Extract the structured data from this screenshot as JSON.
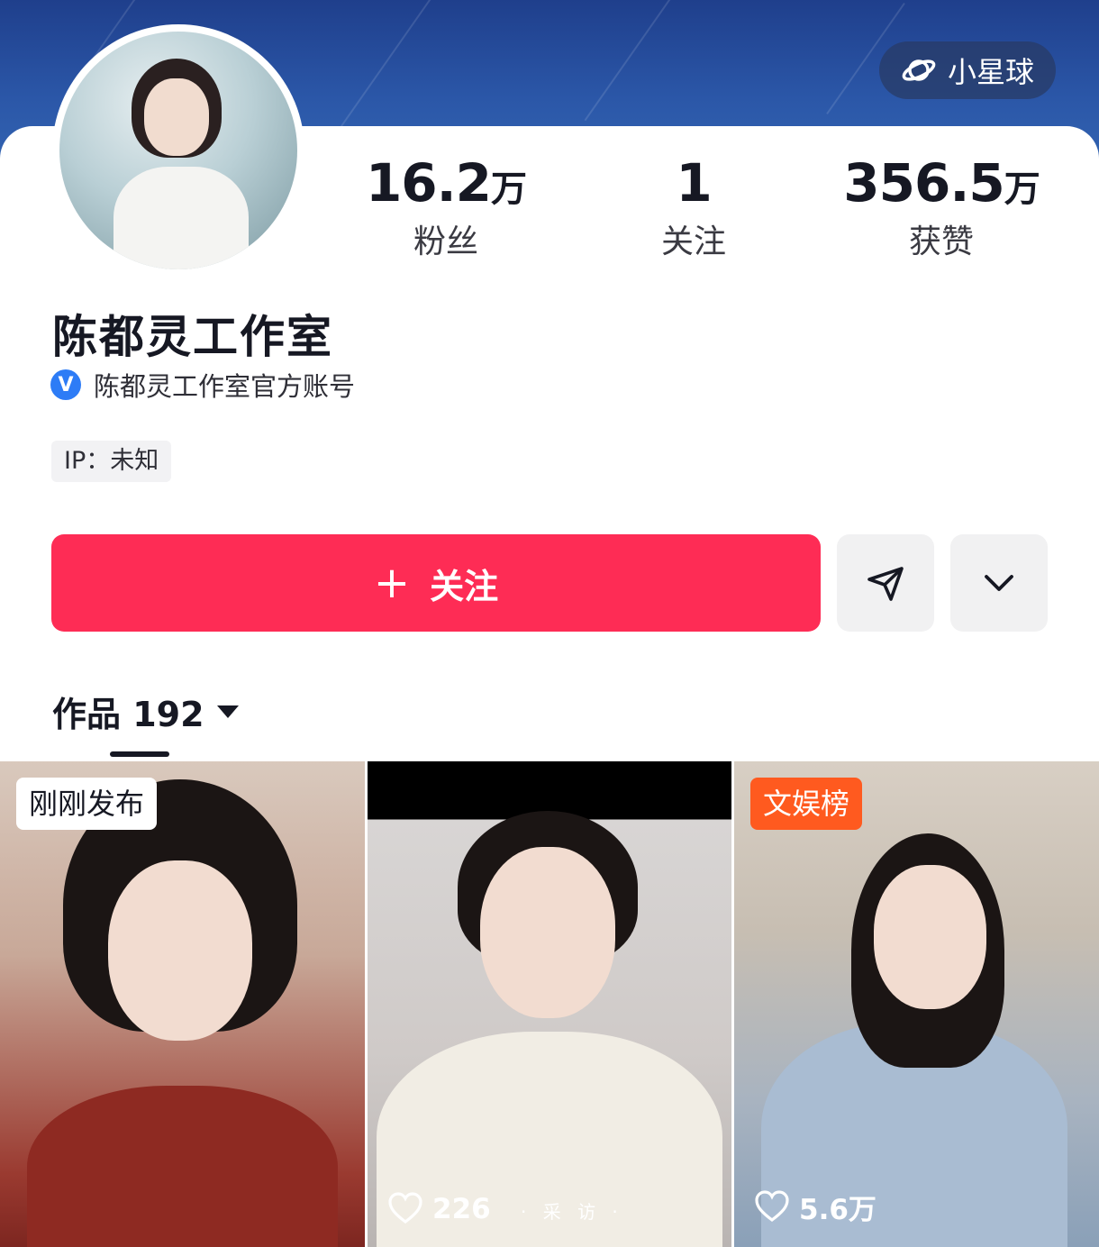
{
  "header": {
    "planet_button_label": "小星球"
  },
  "stats": [
    {
      "number": "16.2",
      "unit": "万",
      "label": "粉丝"
    },
    {
      "number": "1",
      "unit": "",
      "label": "关注"
    },
    {
      "number": "356.5",
      "unit": "万",
      "label": "获赞"
    }
  ],
  "profile": {
    "name": "陈都灵工作室",
    "verify_badge": "V",
    "verification": "陈都灵工作室官方账号",
    "ip": "IP：未知"
  },
  "actions": {
    "follow_plus": "+",
    "follow_label": "关注",
    "share_icon": "send-icon",
    "more_icon": "chevron-down-icon"
  },
  "tabs": {
    "works_label": "作品 192"
  },
  "videos": [
    {
      "badge": "刚刚发布",
      "likes": ""
    },
    {
      "badge": "",
      "likes": "226",
      "caption": "· 采 访 ·"
    },
    {
      "badge": "文娱榜",
      "likes": "5.6万"
    }
  ],
  "colors": {
    "primary": "#fe2c55",
    "banner": "#2b57a8",
    "hot_badge": "#ff5a1f",
    "verified": "#2d7cf6"
  }
}
